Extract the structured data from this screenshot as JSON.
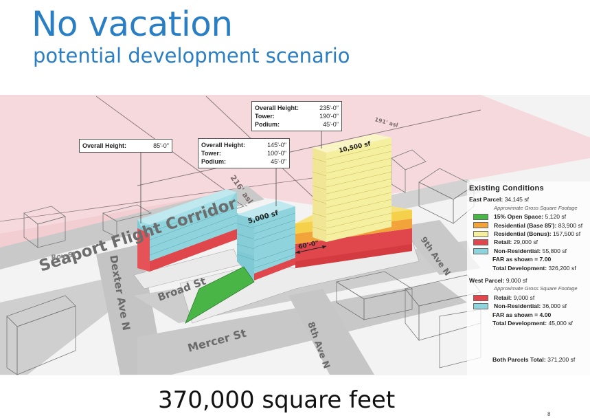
{
  "title": "No vacation",
  "subtitle": "potential development scenario",
  "footer": "370,000 square feet",
  "slide_number": "8",
  "streets": {
    "roy": "Roy St",
    "seaport": "Seaport Flight Corridor",
    "dexter": "Dexter Ave N",
    "broad": "Broad St",
    "mercer": "Mercer St",
    "eighth": "8th Ave N",
    "ninth": "9th Ave N",
    "asl216": "216' asl",
    "asl191": "191' asl"
  },
  "tower_labels": {
    "west": "5,000 sf",
    "east": "10,500 sf",
    "gap": "60'-0\""
  },
  "callouts": {
    "left": {
      "rows": [
        {
          "label": "Overall Height:",
          "value": "85'-0\""
        }
      ]
    },
    "mid": {
      "rows": [
        {
          "label": "Overall Height:",
          "value": "145'-0\""
        },
        {
          "label": "Tower:",
          "value": "100'-0\""
        },
        {
          "label": "Podium:",
          "value": "45'-0\""
        }
      ]
    },
    "right": {
      "rows": [
        {
          "label": "Overall Height:",
          "value": "235'-0\""
        },
        {
          "label": "Tower:",
          "value": "190'-0\""
        },
        {
          "label": "Podium:",
          "value": "45'-0\""
        }
      ]
    }
  },
  "legend": {
    "heading": "Existing Conditions",
    "east": {
      "label": "East Parcel:",
      "value": "34,145 sf",
      "note": "Approximate Gross Square Footage",
      "items": [
        {
          "label": "15% Open Space:",
          "value": "5,120 sf",
          "color": "#49b547"
        },
        {
          "label": "Residential (Base 85'):",
          "value": "83,900 sf",
          "color": "#f2a33a"
        },
        {
          "label": "Residential (Bonus):",
          "value": "157,500 sf",
          "color": "#f5efa0"
        },
        {
          "label": "Retail:",
          "value": "29,000 sf",
          "color": "#e0474c"
        },
        {
          "label": "Non-Residential:",
          "value": "55,800 sf",
          "color": "#8fd3dc"
        }
      ],
      "far_label": "FAR as shown =",
      "far_value": "7.00",
      "total_label": "Total Development:",
      "total_value": "326,200 sf"
    },
    "west": {
      "label": "West Parcel:",
      "value": "9,000 sf",
      "note": "Approximate Gross Square Footage",
      "items": [
        {
          "label": "Retail:",
          "value": "9,000 sf",
          "color": "#e0474c"
        },
        {
          "label": "Non-Residential:",
          "value": "36,000 sf",
          "color": "#8fd3dc"
        }
      ],
      "far_label": "FAR as shown =",
      "far_value": "4.00",
      "total_label": "Total Development:",
      "total_value": "45,000 sf"
    },
    "both_label": "Both Parcels Total:",
    "both_value": "371,200 sf"
  }
}
